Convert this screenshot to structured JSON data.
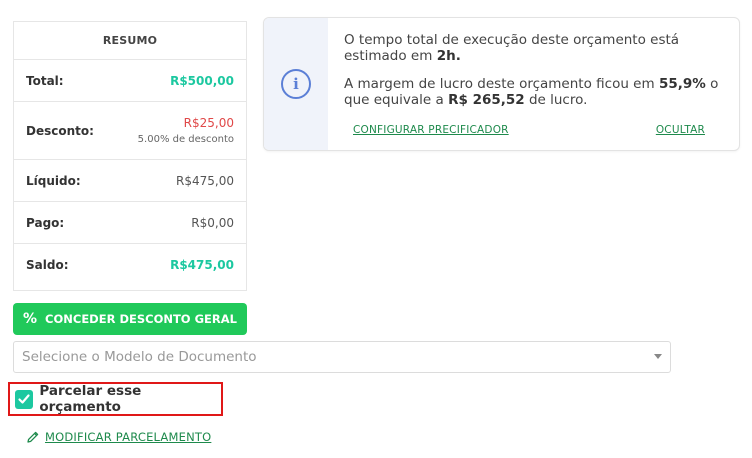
{
  "summary": {
    "title": "RESUMO",
    "rows": [
      {
        "label": "Total:",
        "value": "R$500,00"
      },
      {
        "label": "Desconto:",
        "value": "R$25,00",
        "sub": "5.00% de desconto"
      },
      {
        "label": "Líquido:",
        "value": "R$475,00"
      },
      {
        "label": "Pago:",
        "value": "R$0,00"
      },
      {
        "label": "Saldo:",
        "value": "R$475,00"
      }
    ]
  },
  "info": {
    "icon": "info-icon",
    "time_text": "O tempo total de execução deste orçamento está estimado em ",
    "time_value": "2h.",
    "margin_text": "A margem de lucro deste orçamento ficou em ",
    "margin_value": "55,9%",
    "margin_mid": " o que equivale a ",
    "profit_value": "R$ 265,52",
    "profit_suffix": " de lucro.",
    "configure_link": "CONFIGURAR PRECIFICADOR",
    "hide_link": "OCULTAR"
  },
  "discount_button": {
    "label": "CONCEDER DESCONTO GERAL",
    "icon": "percent-icon"
  },
  "document_select": {
    "placeholder": "Selecione o Modelo de Documento"
  },
  "installments": {
    "label": "Parcelar esse orçamento",
    "checked": true
  },
  "modify_link": {
    "label": "MODIFICAR PARCELAMENTO",
    "icon": "pencil-icon"
  },
  "colors": {
    "accent_green": "#20c95a",
    "teal": "#1cc8a0",
    "red": "#e04848",
    "link_green": "#1e8a4c",
    "info_blue": "#5b7fd6",
    "highlight_border": "#e01818"
  }
}
